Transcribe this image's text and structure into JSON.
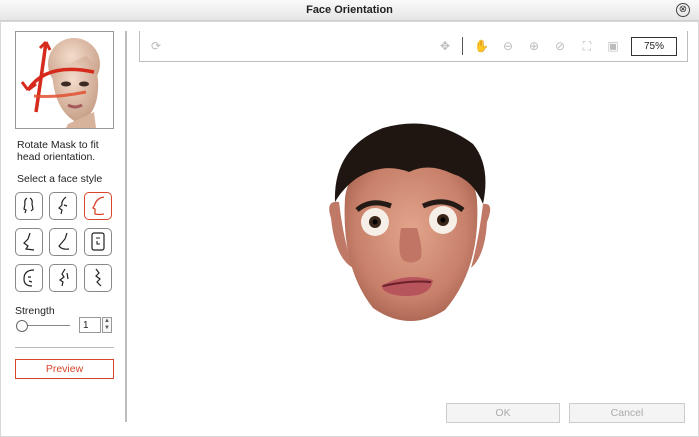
{
  "window": {
    "title": "Face Orientation",
    "close_icon": "⊗"
  },
  "sidebar": {
    "thumbnail_icon": "head-rotate-icon",
    "hint": "Rotate Mask to fit head orientation.",
    "select_label": "Select a face style",
    "face_styles": [
      {
        "name": "front",
        "active": false
      },
      {
        "name": "quarter-left",
        "active": false
      },
      {
        "name": "profile-right",
        "active": true
      },
      {
        "name": "profile-chin",
        "active": false
      },
      {
        "name": "profile-jaw",
        "active": false
      },
      {
        "name": "front-square",
        "active": false
      },
      {
        "name": "round-left",
        "active": false
      },
      {
        "name": "three-quarter",
        "active": false
      },
      {
        "name": "profile-left",
        "active": false
      }
    ],
    "strength_label": "Strength",
    "strength_value": "1",
    "strength_slider": 0,
    "preview_label": "Preview"
  },
  "toolbar": {
    "icons": [
      "reset-icon",
      "move-icon",
      "hand-icon",
      "zoom-out-icon",
      "zoom-in-icon",
      "zoom-reset-icon",
      "fit-icon",
      "actual-size-icon"
    ],
    "zoom_value": "75%"
  },
  "footer": {
    "ok_label": "OK",
    "cancel_label": "Cancel"
  },
  "colors": {
    "accent": "#d9452b",
    "disabled_text": "#aaaaaa"
  }
}
